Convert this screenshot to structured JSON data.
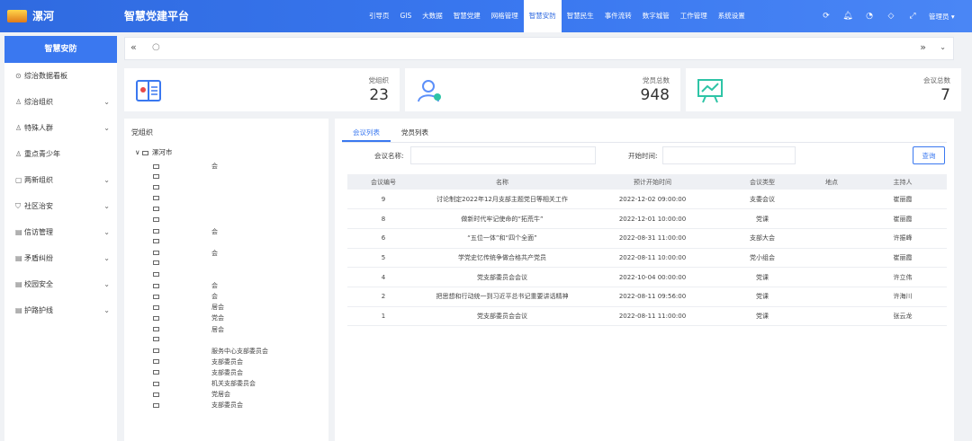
{
  "header": {
    "brand": "漯河",
    "platform_title": "智慧党建平台",
    "nav": [
      "引导页",
      "GIS",
      "大数据",
      "智慧党建",
      "网格管理",
      "智慧安防",
      "智慧民生",
      "事件流转",
      "数字城管",
      "工作管理",
      "系统设置"
    ],
    "active_nav": "智慧安防",
    "user": "管理员 ▾"
  },
  "sidebar": {
    "title": "智慧安防",
    "items": [
      {
        "label": "综治数据看板",
        "icon": "chart-icon",
        "expandable": false
      },
      {
        "label": "综治组织",
        "icon": "user-icon",
        "expandable": true
      },
      {
        "label": "特殊人群",
        "icon": "user-icon",
        "expandable": true
      },
      {
        "label": "重点青少年",
        "icon": "user-icon",
        "expandable": false
      },
      {
        "label": "两新组织",
        "icon": "building-icon",
        "expandable": true
      },
      {
        "label": "社区治安",
        "icon": "shield-icon",
        "expandable": true
      },
      {
        "label": "信访管理",
        "icon": "doc-icon",
        "expandable": true
      },
      {
        "label": "矛盾纠纷",
        "icon": "doc-icon",
        "expandable": true
      },
      {
        "label": "校园安全",
        "icon": "doc-icon",
        "expandable": true
      },
      {
        "label": "护路护线",
        "icon": "doc-icon",
        "expandable": true
      }
    ]
  },
  "tabsbar": {
    "left": "«",
    "right": "»",
    "home": "○",
    "dropdown": "⌄"
  },
  "stats": [
    {
      "label": "党组织",
      "value": "23",
      "color": "#3a78f0"
    },
    {
      "label": "党员总数",
      "value": "948",
      "color": "#5b8ff9"
    },
    {
      "label": "会议总数",
      "value": "7",
      "color": "#2ec4a6"
    }
  ],
  "tree": {
    "title": "党组织",
    "root": "漯河市",
    "nodes": [
      "会",
      "",
      "",
      "",
      "",
      "",
      "会",
      "",
      "会",
      "",
      "",
      "会",
      "会",
      "居会",
      "党会",
      "居会",
      "",
      "服务中心支部委员会",
      "支部委员会",
      "支部委员会",
      "机关支部委员会",
      "党居会",
      "支部委员会"
    ]
  },
  "meeting": {
    "tabs": [
      "会议列表",
      "党员列表"
    ],
    "active_tab": "会议列表",
    "filter": {
      "name_label": "会议名称:",
      "name_value": "",
      "time_label": "开始时间:",
      "time_value": "",
      "query_label": "查询"
    },
    "columns": [
      "会议编号",
      "名称",
      "预计开始时间",
      "会议类型",
      "地点",
      "主持人"
    ],
    "rows": [
      [
        "9",
        "讨论制定2022年12月支部主题党日等相关工作",
        "2022-12-02 09:00:00",
        "支委会议",
        "",
        "崔丽霞"
      ],
      [
        "8",
        "做新时代牢记使命的“拓荒牛”",
        "2022-12-01 10:00:00",
        "党课",
        "",
        "崔丽霞"
      ],
      [
        "6",
        "“五位一体”和“四个全面”",
        "2022-08-31 11:00:00",
        "支部大会",
        "",
        "许振峰"
      ],
      [
        "5",
        "学党史忆传统争做合格共产党员",
        "2022-08-11 10:00:00",
        "党小组会",
        "",
        "崔丽霞"
      ],
      [
        "4",
        "党支部委员会会议",
        "2022-10-04 00:00:00",
        "党课",
        "",
        "许立伟"
      ],
      [
        "2",
        "把思想和行动统一到习近平总书记重要讲话精神",
        "2022-08-11 09:56:00",
        "党课",
        "",
        "许海川"
      ],
      [
        "1",
        "党支部委员会会议",
        "2022-08-11 11:00:00",
        "党课",
        "",
        "张云龙"
      ]
    ]
  }
}
